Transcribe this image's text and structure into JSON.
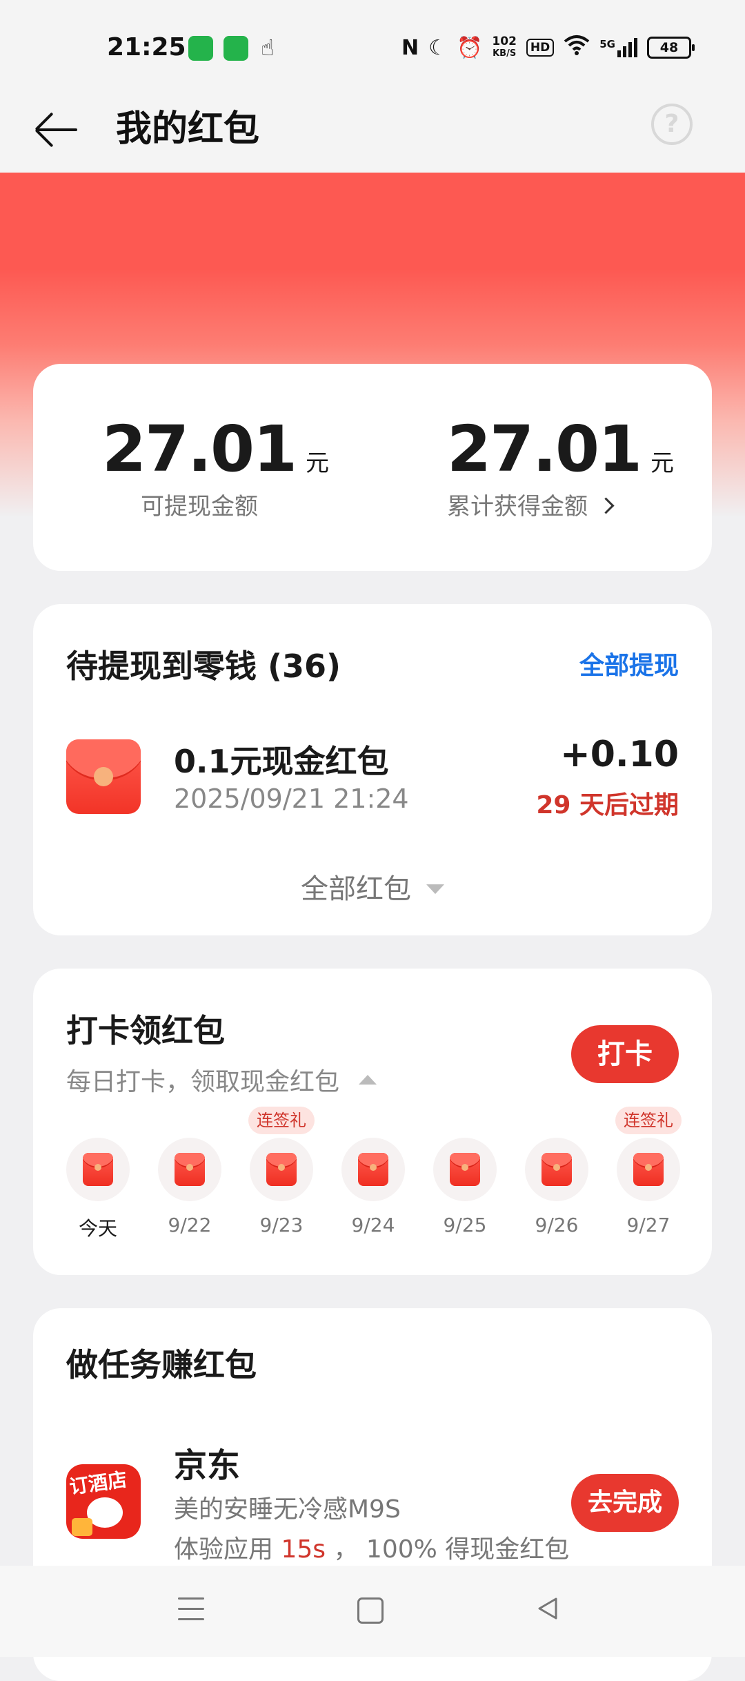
{
  "status_bar": {
    "time": "21:25",
    "net_speed_value": "102",
    "net_speed_unit": "KB/S",
    "hd": "HD",
    "network": "5G",
    "battery": "48"
  },
  "header": {
    "title": "我的红包",
    "help_glyph": "?"
  },
  "balance": {
    "withdrawable_amount": "27.01",
    "withdrawable_unit": "元",
    "withdrawable_label": "可提现金额",
    "total_amount": "27.01",
    "total_unit": "元",
    "total_label": "累计获得金额"
  },
  "pending": {
    "title": "待提现到零钱 (36)",
    "withdraw_all": "全部提现",
    "item": {
      "title": "0.1元现金红包",
      "date": "2025/09/21 21:24",
      "amount": "+0.10",
      "expiry": "29 天后过期"
    },
    "all_packets": "全部红包"
  },
  "checkin": {
    "title": "打卡领红包",
    "subtitle": "每日打卡，领取现金红包",
    "button": "打卡",
    "days": [
      {
        "label": "今天"
      },
      {
        "label": "9/22"
      },
      {
        "label": "9/23",
        "tag": "连签礼"
      },
      {
        "label": "9/24"
      },
      {
        "label": "9/25"
      },
      {
        "label": "9/26"
      },
      {
        "label": "9/27",
        "tag": "连签礼"
      }
    ]
  },
  "tasks": {
    "title": "做任务赚红包",
    "item": {
      "logo_text": "订酒店",
      "name": "京东",
      "desc": "美的安睡无冷感M9S",
      "reward_prefix": "体验应用 ",
      "reward_highlight": "15s",
      "reward_suffix": " ， 100% 得现金红包",
      "button": "去完成"
    }
  },
  "colors": {
    "accent_red": "#e8382f",
    "hero_red": "#fd5952",
    "link_blue": "#1a73e8",
    "expiry_red": "#d0352b"
  }
}
